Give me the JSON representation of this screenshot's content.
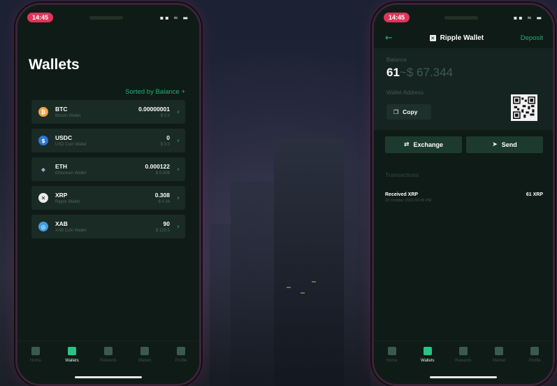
{
  "left_phone": {
    "status_time": "14:45",
    "title": "Wallets",
    "sort_label": "Sorted by Balance +",
    "wallets": [
      {
        "symbol": "BTC",
        "name": "Bitcoin Wallet",
        "balance": "0.00000001",
        "usd": "$ 0.0",
        "icon": "bitcoin-icon",
        "color": "#f2a33a",
        "glyph": "₿"
      },
      {
        "symbol": "USDC",
        "name": "USD Coin Wallet",
        "balance": "0",
        "usd": "$ 0.0",
        "icon": "usdc-icon",
        "color": "#2d78d6",
        "glyph": "$"
      },
      {
        "symbol": "ETH",
        "name": "Ethereum Wallet",
        "balance": "0.000122",
        "usd": "$ 0.008",
        "icon": "ethereum-icon",
        "color": "#1a2a25",
        "glyph": "◆"
      },
      {
        "symbol": "XRP",
        "name": "Ripple Wallet",
        "balance": "0.308",
        "usd": "$ 0.34",
        "icon": "xrp-icon",
        "color": "#e9ecea",
        "glyph": "✕"
      },
      {
        "symbol": "XAB",
        "name": "XAB Coin Wallet",
        "balance": "90",
        "usd": "$ 129.5",
        "icon": "xab-icon",
        "color": "#3f9de0",
        "glyph": "◎"
      }
    ],
    "tabs": [
      {
        "label": "Home",
        "active": false
      },
      {
        "label": "Wallets",
        "active": true
      },
      {
        "label": "Rewards",
        "active": false
      },
      {
        "label": "Market",
        "active": false
      },
      {
        "label": "Profile",
        "active": false
      }
    ]
  },
  "right_phone": {
    "status_time": "14:45",
    "nav": {
      "title": "Ripple Wallet",
      "deposit": "Deposit"
    },
    "balance_label": "Balance",
    "balance_amount": "61",
    "balance_usd": "~$ 67.344",
    "address_label": "Wallet Address",
    "copy_label": "Copy",
    "exchange_label": "Exchange",
    "send_label": "Send",
    "transactions_label": "Transactions",
    "transactions": [
      {
        "title": "Received XRP",
        "date": "22 October 2021 02:45 PM",
        "amount": "61 XRP"
      }
    ],
    "tabs": [
      {
        "label": "Home",
        "active": false
      },
      {
        "label": "Wallets",
        "active": true
      },
      {
        "label": "Rewards",
        "active": false
      },
      {
        "label": "Market",
        "active": false
      },
      {
        "label": "Profile",
        "active": false
      }
    ]
  },
  "colors": {
    "accent": "#22b07a",
    "screen_bg": "#0f1b17",
    "card_bg": "#1a2a25",
    "time_pill": "#e0355a"
  }
}
